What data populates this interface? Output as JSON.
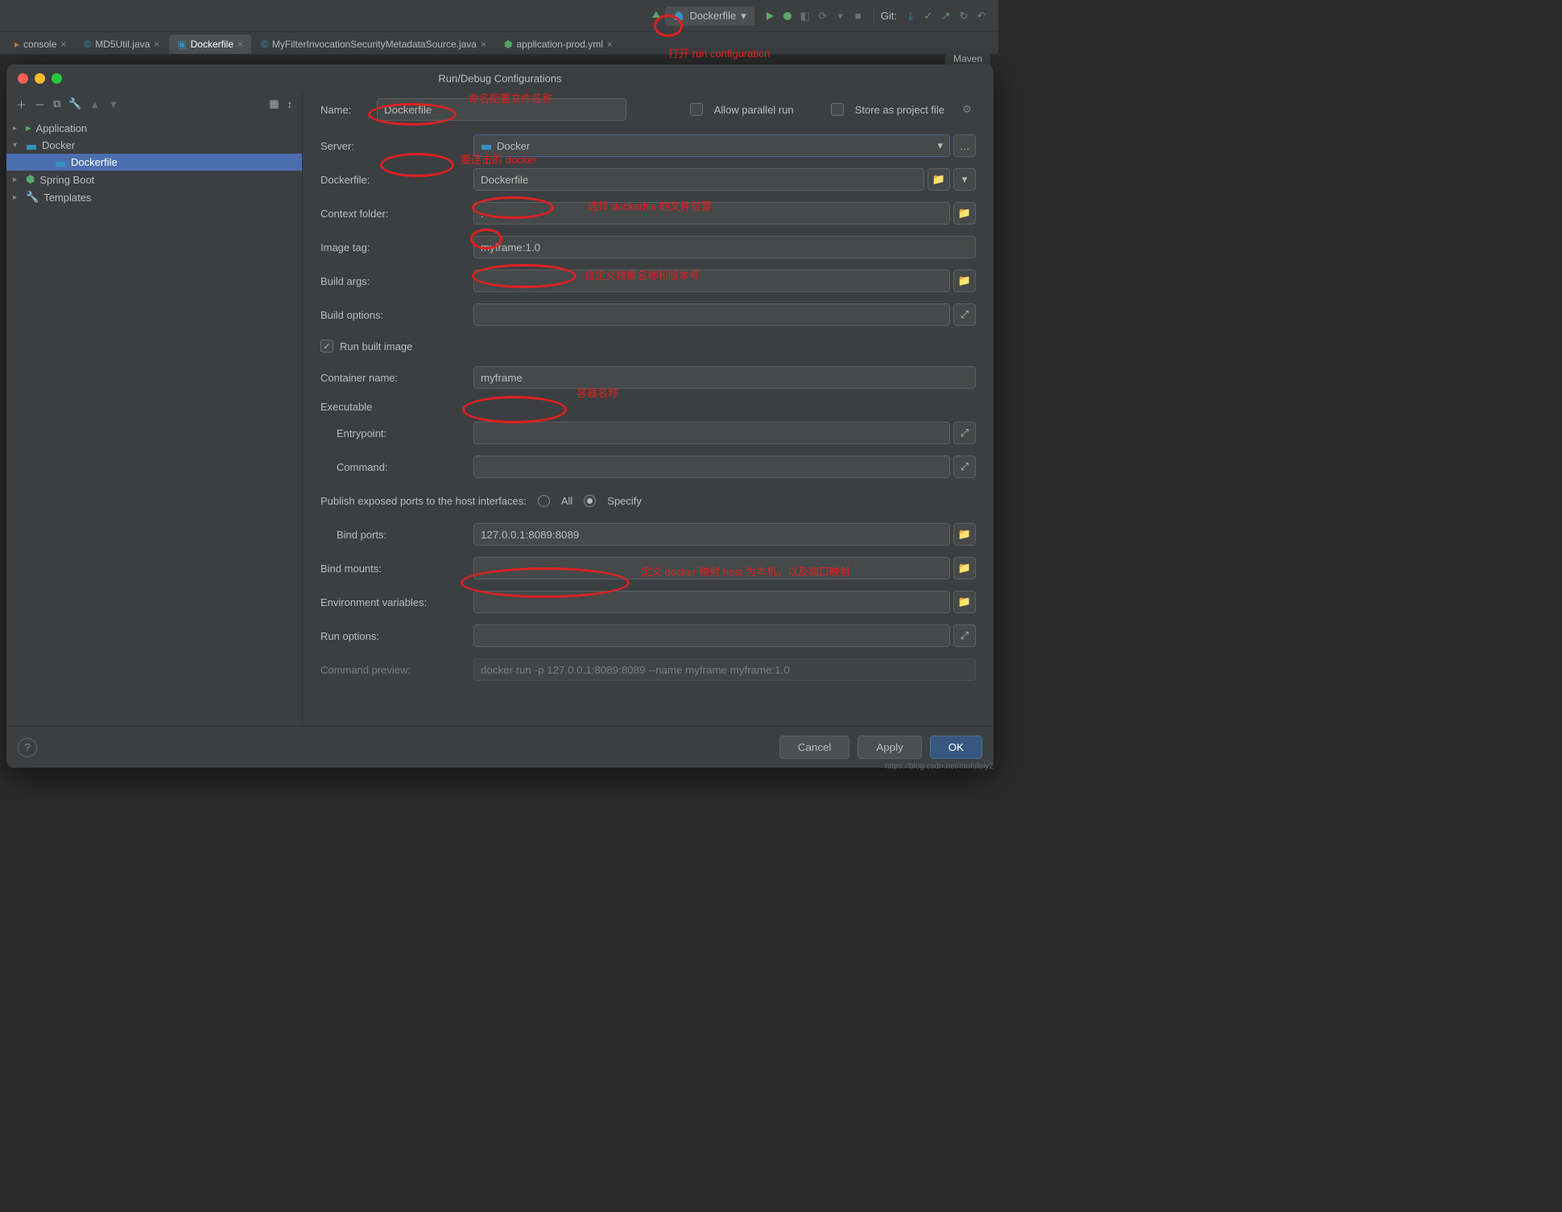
{
  "toolbar": {
    "run_config_selected": "Dockerfile",
    "git_label": "Git:"
  },
  "editor_tabs": [
    "console",
    "MD5Util.java",
    "Dockerfile",
    "MyFilterInvocationSecurityMetadataSource.java",
    "application-prod.yml"
  ],
  "maven_label": "Maven",
  "dialog": {
    "title": "Run/Debug Configurations",
    "tree": {
      "application": "Application",
      "docker": "Docker",
      "docker_child": "Dockerfile",
      "spring_boot": "Spring Boot",
      "templates": "Templates"
    },
    "form": {
      "name_label": "Name:",
      "name_value": "Dockerfile",
      "allow_parallel": "Allow parallel run",
      "store_as_project": "Store as project file",
      "server_label": "Server:",
      "server_value": "Docker",
      "dockerfile_label": "Dockerfile:",
      "dockerfile_value": "Dockerfile",
      "context_label": "Context folder:",
      "context_value": ".",
      "image_tag_label": "Image tag:",
      "image_tag_value": "myframe:1.0",
      "build_args_label": "Build args:",
      "build_options_label": "Build options:",
      "run_built_image": "Run built image",
      "container_name_label": "Container name:",
      "container_name_value": "myframe",
      "executable": "Executable",
      "entrypoint_label": "Entrypoint:",
      "command_label": "Command:",
      "publish_label": "Publish exposed ports to the host interfaces:",
      "radio_all": "All",
      "radio_specify": "Specify",
      "bind_ports_label": "Bind ports:",
      "bind_ports_value": "127.0.0.1:8089:8089",
      "bind_mounts_label": "Bind mounts:",
      "env_vars_label": "Environment variables:",
      "run_options_label": "Run options:",
      "cmd_preview_label": "Command preview:",
      "cmd_preview_value": "docker run -p 127.0.0.1:8089:8089 --name myframe myframe:1.0"
    },
    "footer": {
      "cancel": "Cancel",
      "apply": "Apply",
      "ok": "OK"
    }
  },
  "annotations": {
    "a1": "打开 run configuration",
    "a2": "命名配置文件名称",
    "a3": "要连击的 docker",
    "a4": "选择 dockerfile 的文件位置",
    "a5": "自定义镜像名称和版本号",
    "a6": "容器名称",
    "a7": "定义 docker 映射 host 为本机，以及端口映射"
  },
  "watermark": "https://blog.csdn.net/mofsfely2"
}
